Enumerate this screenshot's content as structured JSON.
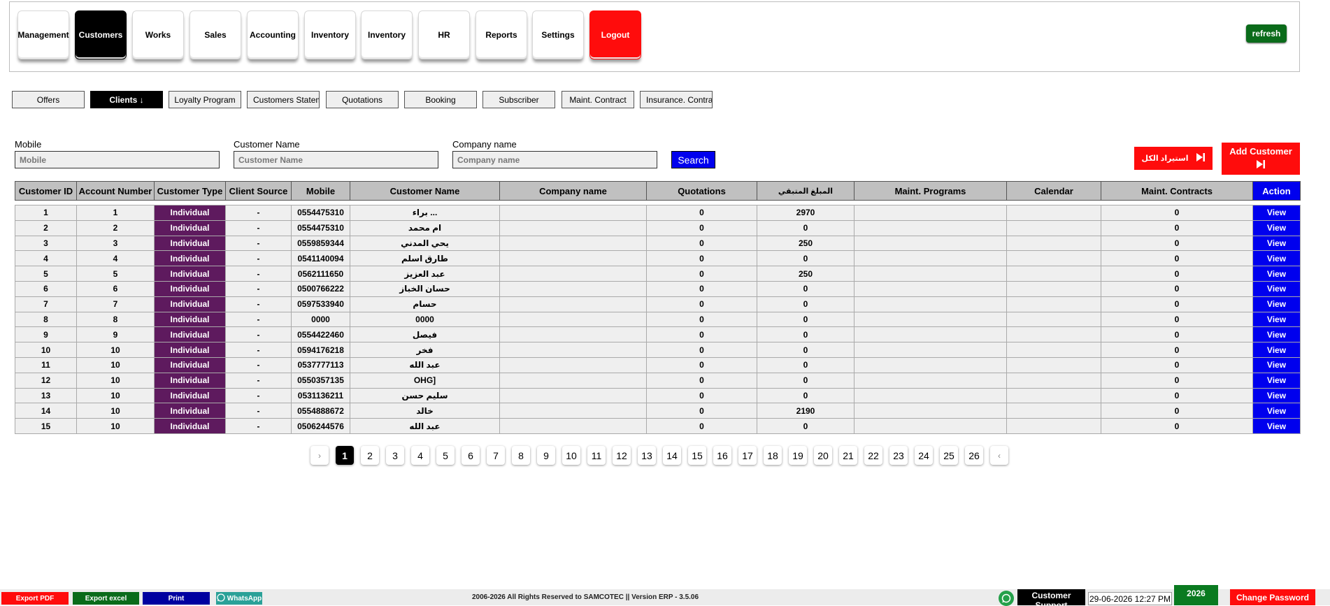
{
  "nav": {
    "items": [
      {
        "label": "Management"
      },
      {
        "label": "Customers"
      },
      {
        "label": "Works"
      },
      {
        "label": "Sales"
      },
      {
        "label": "Accounting"
      },
      {
        "label": "Inventory"
      },
      {
        "label": "Inventory"
      },
      {
        "label": "HR"
      },
      {
        "label": "Reports"
      },
      {
        "label": "Settings"
      },
      {
        "label": "Logout"
      }
    ],
    "active": "Customers",
    "refresh_label": "refresh"
  },
  "subtabs": [
    {
      "label": "Offers"
    },
    {
      "label": "Clients ↓"
    },
    {
      "label": "Loyalty Program"
    },
    {
      "label": "Customers Statement"
    },
    {
      "label": "Quotations"
    },
    {
      "label": "Booking"
    },
    {
      "label": "Subscriber"
    },
    {
      "label": "Maint. Contract"
    },
    {
      "label": "Insurance. Contract"
    }
  ],
  "search": {
    "mobile_label": "Mobile",
    "mobile_placeholder": "Mobile",
    "name_label": "Customer Name",
    "name_placeholder": "Customer Name",
    "company_label": "Company name",
    "company_placeholder": "Company name",
    "search_label": "Search",
    "import_label": "استيراد الكل",
    "add_label": "Add Customer"
  },
  "table": {
    "headers": [
      "Customer ID",
      "Account Number",
      "Customer Type",
      "Client Source",
      "Mobile",
      "Customer Name",
      "Company name",
      "Quotations",
      "المبلغ المتبقي",
      "Maint. Programs",
      "Calendar",
      "Maint. Contracts",
      "Action"
    ],
    "rows": [
      {
        "id": "1",
        "account": "1",
        "type": "Individual",
        "source": "-",
        "mobile": "0554475310",
        "name": "براء ...",
        "company": "",
        "quotations": "0",
        "remaining": "2970",
        "programs": "",
        "calendar": "",
        "contracts": "0",
        "action": "View"
      },
      {
        "id": "2",
        "account": "2",
        "type": "Individual",
        "source": "-",
        "mobile": "0554475310",
        "name": "ام محمد",
        "company": "",
        "quotations": "0",
        "remaining": "0",
        "programs": "",
        "calendar": "",
        "contracts": "0",
        "action": "View"
      },
      {
        "id": "3",
        "account": "3",
        "type": "Individual",
        "source": "-",
        "mobile": "0559859344",
        "name": "يحي المدني",
        "company": "",
        "quotations": "0",
        "remaining": "250",
        "programs": "",
        "calendar": "",
        "contracts": "0",
        "action": "View"
      },
      {
        "id": "4",
        "account": "4",
        "type": "Individual",
        "source": "-",
        "mobile": "0541140094",
        "name": "طارق اسلم",
        "company": "",
        "quotations": "0",
        "remaining": "0",
        "programs": "",
        "calendar": "",
        "contracts": "0",
        "action": "View"
      },
      {
        "id": "5",
        "account": "5",
        "type": "Individual",
        "source": "-",
        "mobile": "0562111650",
        "name": "عبد العزيز",
        "company": "",
        "quotations": "0",
        "remaining": "250",
        "programs": "",
        "calendar": "",
        "contracts": "0",
        "action": "View"
      },
      {
        "id": "6",
        "account": "6",
        "type": "Individual",
        "source": "-",
        "mobile": "0500766222",
        "name": "حسان الخباز",
        "company": "",
        "quotations": "0",
        "remaining": "0",
        "programs": "",
        "calendar": "",
        "contracts": "0",
        "action": "View"
      },
      {
        "id": "7",
        "account": "7",
        "type": "Individual",
        "source": "-",
        "mobile": "0597533940",
        "name": "حسام",
        "company": "",
        "quotations": "0",
        "remaining": "0",
        "programs": "",
        "calendar": "",
        "contracts": "0",
        "action": "View"
      },
      {
        "id": "8",
        "account": "8",
        "type": "Individual",
        "source": "-",
        "mobile": "0000",
        "name": "0000",
        "company": "",
        "quotations": "0",
        "remaining": "0",
        "programs": "",
        "calendar": "",
        "contracts": "0",
        "action": "View"
      },
      {
        "id": "9",
        "account": "9",
        "type": "Individual",
        "source": "-",
        "mobile": "0554422460",
        "name": "فيصل",
        "company": "",
        "quotations": "0",
        "remaining": "0",
        "programs": "",
        "calendar": "",
        "contracts": "0",
        "action": "View"
      },
      {
        "id": "10",
        "account": "10",
        "type": "Individual",
        "source": "-",
        "mobile": "0594176218",
        "name": "فخر",
        "company": "",
        "quotations": "0",
        "remaining": "0",
        "programs": "",
        "calendar": "",
        "contracts": "0",
        "action": "View"
      },
      {
        "id": "11",
        "account": "10",
        "type": "Individual",
        "source": "-",
        "mobile": "0537777113",
        "name": "عبد الله",
        "company": "",
        "quotations": "0",
        "remaining": "0",
        "programs": "",
        "calendar": "",
        "contracts": "0",
        "action": "View"
      },
      {
        "id": "12",
        "account": "10",
        "type": "Individual",
        "source": "-",
        "mobile": "0550357135",
        "name": "OHG]",
        "company": "",
        "quotations": "0",
        "remaining": "0",
        "programs": "",
        "calendar": "",
        "contracts": "0",
        "action": "View"
      },
      {
        "id": "13",
        "account": "10",
        "type": "Individual",
        "source": "-",
        "mobile": "0531136211",
        "name": "سليم حسن",
        "company": "",
        "quotations": "0",
        "remaining": "0",
        "programs": "",
        "calendar": "",
        "contracts": "0",
        "action": "View"
      },
      {
        "id": "14",
        "account": "10",
        "type": "Individual",
        "source": "-",
        "mobile": "0554888672",
        "name": "خالد",
        "company": "",
        "quotations": "0",
        "remaining": "2190",
        "programs": "",
        "calendar": "",
        "contracts": "0",
        "action": "View"
      },
      {
        "id": "15",
        "account": "10",
        "type": "Individual",
        "source": "-",
        "mobile": "0506244576",
        "name": "عبد الله",
        "company": "",
        "quotations": "0",
        "remaining": "0",
        "programs": "",
        "calendar": "",
        "contracts": "0",
        "action": "View"
      }
    ]
  },
  "pagination": {
    "prev": "›",
    "next": "‹",
    "current": "1",
    "pages": [
      "1",
      "2",
      "3",
      "4",
      "5",
      "6",
      "7",
      "8",
      "9",
      "10",
      "11",
      "12",
      "13",
      "14",
      "15",
      "16",
      "17",
      "18",
      "19",
      "20",
      "21",
      "22",
      "23",
      "24",
      "25",
      "26"
    ]
  },
  "footer": {
    "export_pdf": "Export PDF",
    "export_excel": "Export excel",
    "print": "Print",
    "whatsapp": "WhatsApp",
    "copyright": "2006-2026 All Rights Reserved to SAMCOTEC || Version ERP - 3.5.06",
    "support": "Customer Support",
    "datetime": "29-06-2026 12:27 PM",
    "year": "2026",
    "change_password": "Change Password"
  },
  "colors": {
    "accent_blue": "#0000ee",
    "danger_red": "#ff0c0c",
    "success_green": "#0a6b1a",
    "type_purple": "#5e1a5e"
  }
}
